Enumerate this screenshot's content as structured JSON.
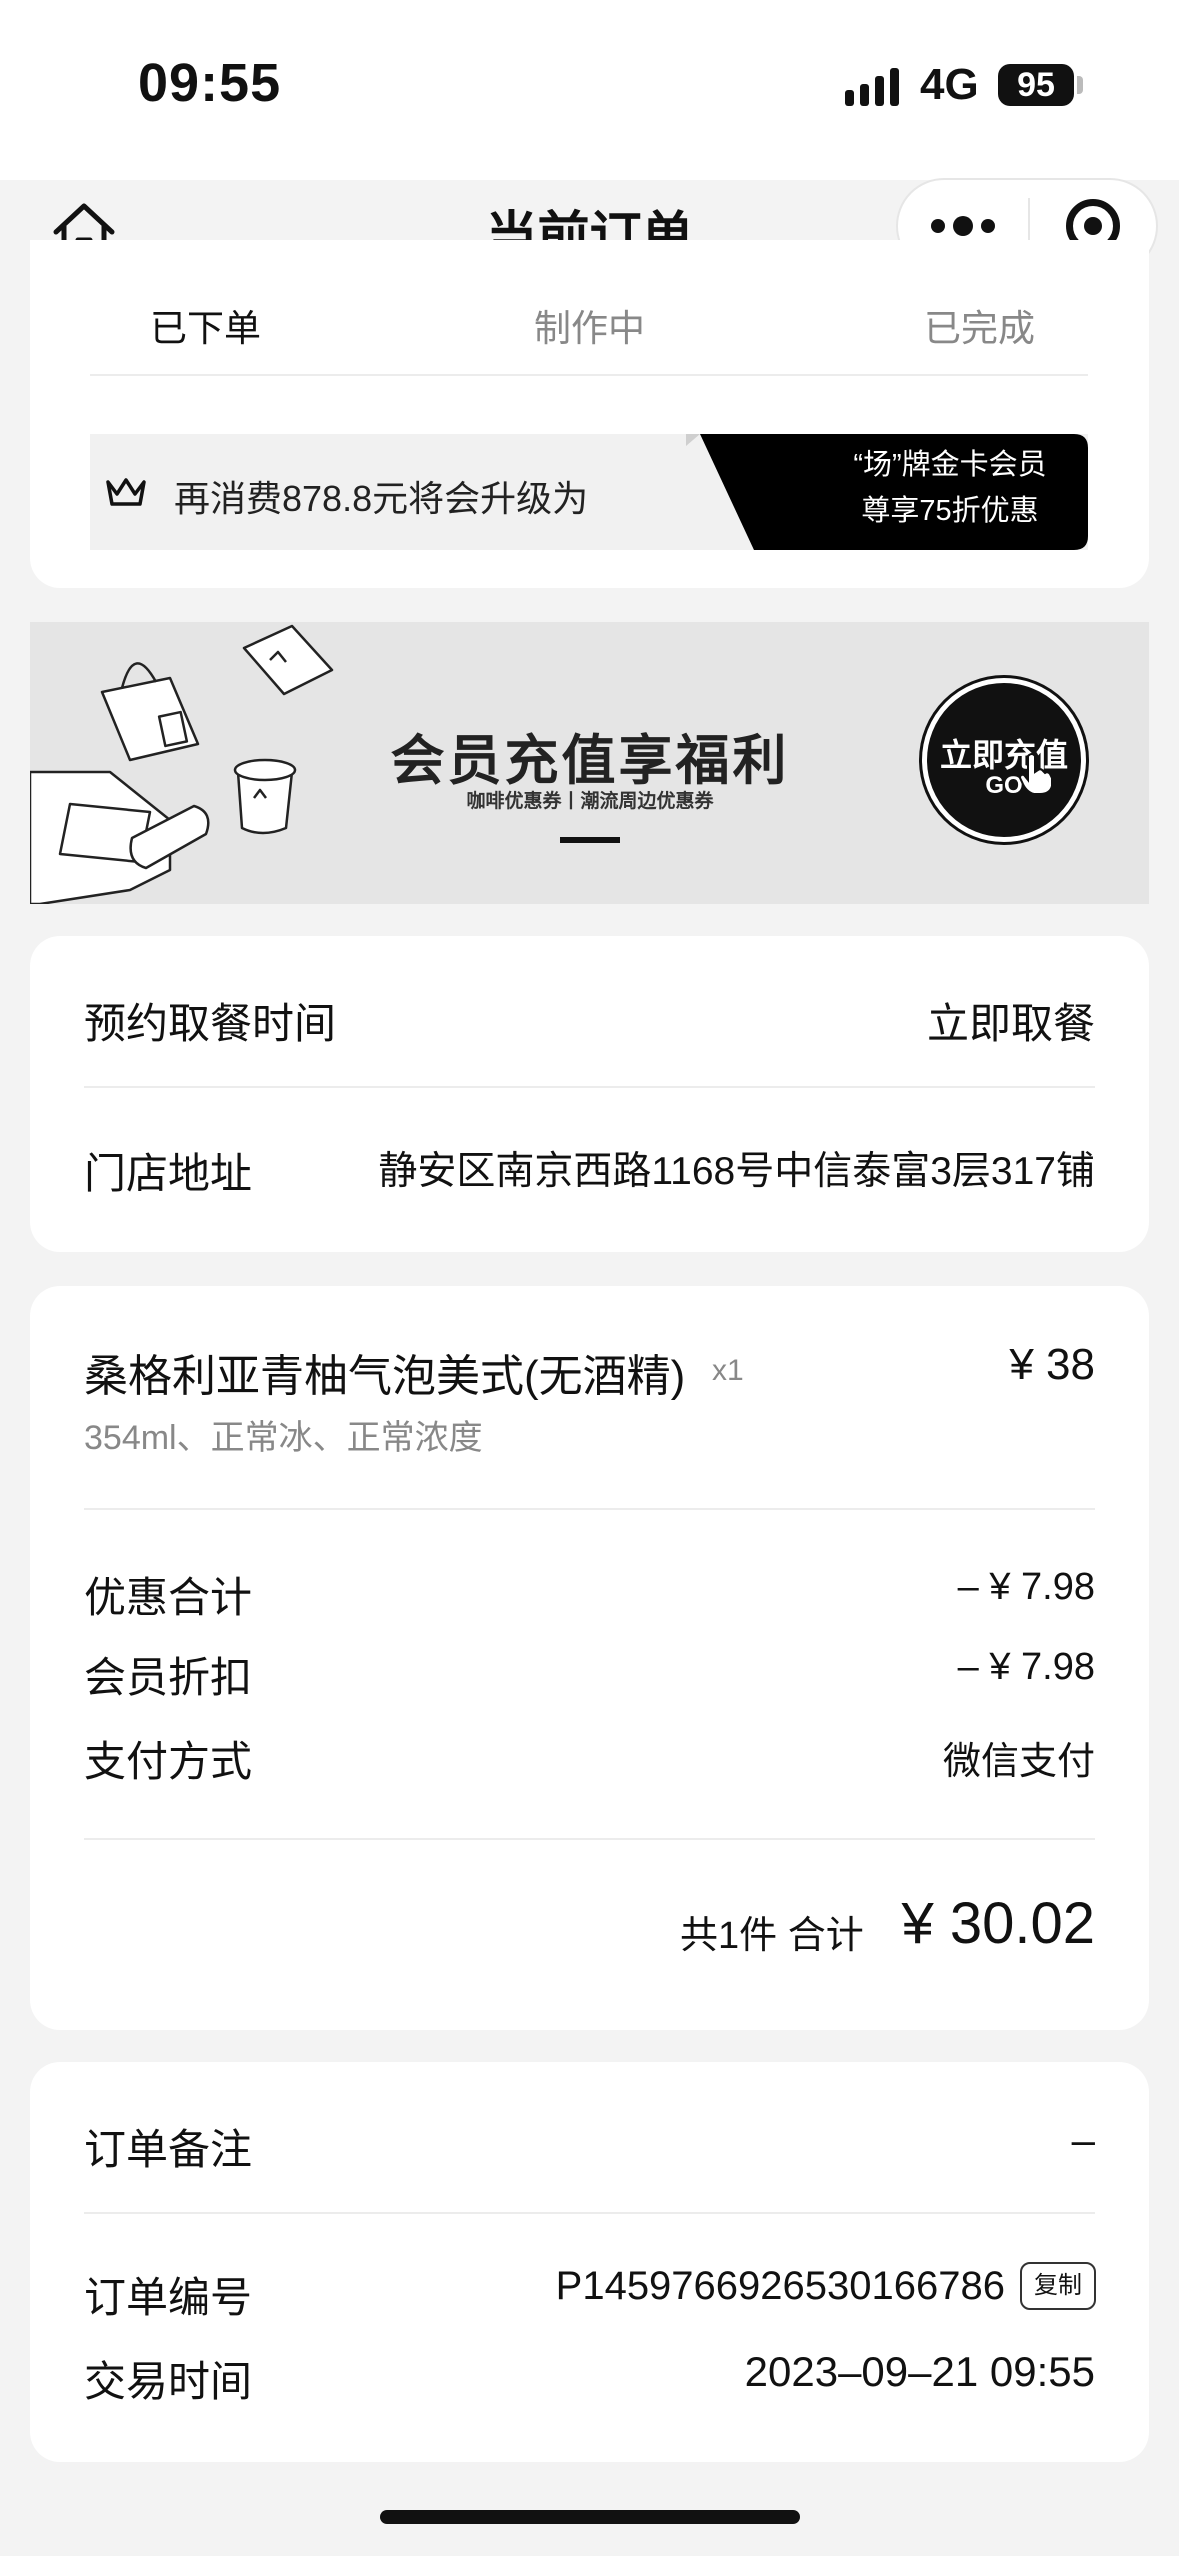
{
  "status_bar": {
    "time": "09:55",
    "network": "4G",
    "battery": "95"
  },
  "nav": {
    "title": "当前订单"
  },
  "tabs": [
    {
      "label": "已下单",
      "active": true
    },
    {
      "label": "制作中",
      "active": false
    },
    {
      "label": "已完成",
      "active": false
    }
  ],
  "member": {
    "upgrade_text": "再消费878.8元将会升级为",
    "tier_line1": "“场”牌金卡会员",
    "tier_line2": "尊享75折优惠"
  },
  "banner": {
    "title": "会员充值享福利",
    "subtitle": "咖啡优惠券丨潮流周边优惠券",
    "cta_label": "立即充值",
    "cta_sub": "GO"
  },
  "pickup": {
    "time_label": "预约取餐时间",
    "time_value": "立即取餐",
    "address_label": "门店地址",
    "address_value": "静安区南京西路1168号中信泰富3层317铺"
  },
  "order_item": {
    "name": "桑格利亚青柚气泡美式(无酒精)",
    "qty": "x1",
    "price": "¥ 38",
    "spec": "354ml、正常冰、正常浓度"
  },
  "summary": {
    "discount_label": "优惠合计",
    "discount_value": "– ¥ 7.98",
    "member_discount_label": "会员折扣",
    "member_discount_value": "– ¥ 7.98",
    "payment_label": "支付方式",
    "payment_value": "微信支付",
    "total_label": "共1件  合计",
    "total_value": "¥ 30.02"
  },
  "order_info": {
    "note_label": "订单备注",
    "note_value": "–",
    "number_label": "订单编号",
    "number_value": "P1459766926530166786",
    "copy_label": "复制",
    "time_label": "交易时间",
    "time_value": "2023–09–21 09:55"
  },
  "colors": {
    "background": "#f3f3f3",
    "card": "#ffffff",
    "accent": "#111111",
    "muted": "#888888"
  }
}
